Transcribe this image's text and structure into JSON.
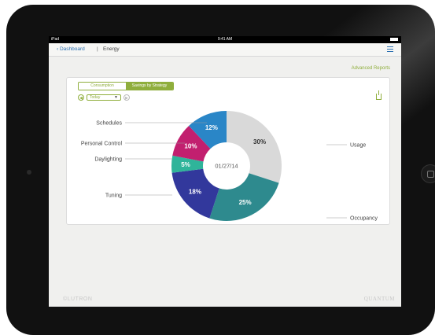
{
  "status_bar": {
    "carrier": "iPad",
    "time": "9:41 AM"
  },
  "nav": {
    "back_label": "Dashboard",
    "separator": "|",
    "title": "Energy"
  },
  "advanced_reports": "Advanced Reports",
  "tabs": [
    {
      "label": "Consumption"
    },
    {
      "label": "Savings by Strategy"
    }
  ],
  "date_control": {
    "prev": "◀",
    "period": "Today",
    "caret": "▼",
    "next": "▶"
  },
  "footer": {
    "left_brand": "©LUTRON",
    "right_brand": "QUANTUM"
  },
  "chart_data": {
    "type": "pie",
    "center_label": "01/27/14",
    "slices": [
      {
        "name": "Usage",
        "value": 30,
        "label": "30%",
        "color": "#d9d9d9"
      },
      {
        "name": "Occupancy",
        "value": 25,
        "label": "25%",
        "color": "#2e8a8e"
      },
      {
        "name": "Tuning",
        "value": 18,
        "label": "18%",
        "color": "#32389c"
      },
      {
        "name": "Daylighting",
        "value": 5,
        "label": "5%",
        "color": "#2fb49a"
      },
      {
        "name": "Personal Control",
        "value": 10,
        "label": "10%",
        "color": "#c21f6f"
      },
      {
        "name": "Schedules",
        "value": 12,
        "label": "12%",
        "color": "#2a86c7"
      }
    ]
  }
}
